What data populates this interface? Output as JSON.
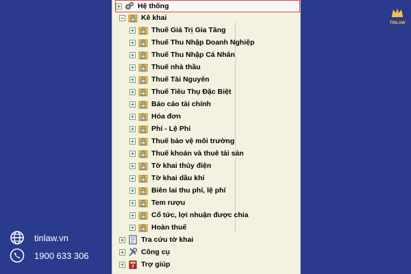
{
  "tree": {
    "items": [
      {
        "label": "Hệ thống",
        "icon": "settings-gears-icon",
        "level": 0,
        "expanded": false,
        "selected": true
      },
      {
        "label": "Kê khai",
        "icon": "folder-lock-icon",
        "level": 0,
        "expanded": true,
        "selected": false
      },
      {
        "label": "Thuế Giá Trị Gia Tăng",
        "icon": "folder-lock-icon",
        "level": 1
      },
      {
        "label": "Thuế Thu Nhập Doanh Nghiệp",
        "icon": "folder-lock-icon",
        "level": 1
      },
      {
        "label": "Thuế Thu Nhập Cá Nhân",
        "icon": "folder-lock-icon",
        "level": 1
      },
      {
        "label": "Thuế nhà thầu",
        "icon": "folder-lock-icon",
        "level": 1
      },
      {
        "label": "Thuế Tài Nguyên",
        "icon": "folder-lock-icon",
        "level": 1
      },
      {
        "label": "Thuế Tiêu Thụ Đặc Biệt",
        "icon": "folder-lock-icon",
        "level": 1
      },
      {
        "label": "Báo cáo tài chính",
        "icon": "folder-lock-icon",
        "level": 1
      },
      {
        "label": "Hóa đơn",
        "icon": "folder-lock-icon",
        "level": 1
      },
      {
        "label": "Phí - Lệ Phí",
        "icon": "folder-lock-icon",
        "level": 1
      },
      {
        "label": "Thuế bảo vệ môi trường",
        "icon": "folder-lock-icon",
        "level": 1
      },
      {
        "label": "Thuế khoán và thuê tài sản",
        "icon": "folder-lock-icon",
        "level": 1
      },
      {
        "label": "Tờ khai thủy điện",
        "icon": "folder-lock-icon",
        "level": 1
      },
      {
        "label": "Tờ khai dầu khí",
        "icon": "folder-lock-icon",
        "level": 1
      },
      {
        "label": "Biên lai thu phí, lệ phí",
        "icon": "folder-lock-icon",
        "level": 1
      },
      {
        "label": "Tem rượu",
        "icon": "folder-lock-icon",
        "level": 1
      },
      {
        "label": "Cổ tức, lợi nhuận được chia",
        "icon": "folder-lock-icon",
        "level": 1
      },
      {
        "label": "Hoàn thuế",
        "icon": "folder-lock-icon",
        "level": 1
      },
      {
        "label": "Tra cứu tờ khai",
        "icon": "lookup-doc-icon",
        "level": 0
      },
      {
        "label": "Công cụ",
        "icon": "tools-icon",
        "level": 0
      },
      {
        "label": "Trợ giúp",
        "icon": "help-book-icon",
        "level": 0
      }
    ]
  },
  "brand": {
    "logo_text": "TINLAW"
  },
  "contact": {
    "website": "tinlaw.vn",
    "phone": "1900 633 306"
  },
  "colors": {
    "background": "#2a3a8c",
    "panel": "#f3f1df",
    "selection_border": "#d24a4a",
    "brand_gold": "#f0c24a"
  }
}
